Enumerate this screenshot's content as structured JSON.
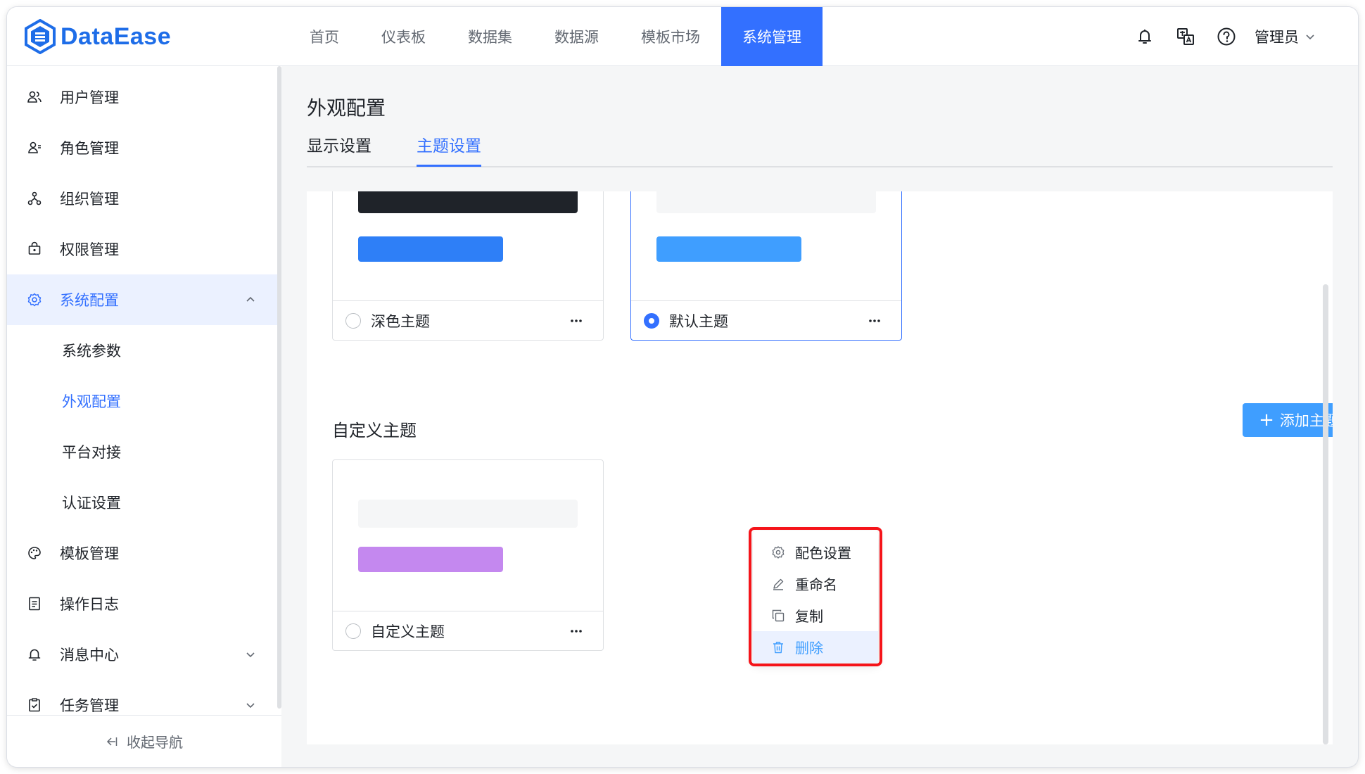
{
  "app": {
    "logo_text": "DataEase"
  },
  "topnav": {
    "items": [
      "首页",
      "仪表板",
      "数据集",
      "数据源",
      "模板市场",
      "系统管理"
    ],
    "active_index": 5
  },
  "header": {
    "icons": [
      "bell-icon",
      "translate-icon",
      "help-icon"
    ],
    "user_name": "管理员"
  },
  "sidebar": {
    "items": [
      {
        "label": "用户管理",
        "icon": "user-icon"
      },
      {
        "label": "角色管理",
        "icon": "role-icon"
      },
      {
        "label": "组织管理",
        "icon": "org-icon"
      },
      {
        "label": "权限管理",
        "icon": "lock-icon"
      },
      {
        "label": "系统配置",
        "icon": "gear-icon",
        "expanded": true
      },
      {
        "label": "系统参数",
        "sub": true
      },
      {
        "label": "外观配置",
        "sub": true,
        "active": true
      },
      {
        "label": "平台对接",
        "sub": true
      },
      {
        "label": "认证设置",
        "sub": true
      },
      {
        "label": "模板管理",
        "icon": "palette-icon"
      },
      {
        "label": "操作日志",
        "icon": "log-icon"
      },
      {
        "label": "消息中心",
        "icon": "bell-icon",
        "chevron": "down"
      },
      {
        "label": "任务管理",
        "icon": "task-icon",
        "chevron": "down"
      }
    ],
    "collapse_label": "收起导航"
  },
  "main": {
    "title": "外观配置",
    "tabs": [
      {
        "label": "显示设置",
        "active": false
      },
      {
        "label": "主题设置",
        "active": true
      }
    ],
    "builtin_themes": [
      {
        "name": "深色主题",
        "selected": false,
        "colors": {
          "top": "#1f2329",
          "bar": "#2e7ff7"
        }
      },
      {
        "name": "默认主题",
        "selected": true,
        "colors": {
          "top": "#f5f6f7",
          "bar": "#3f9eff"
        }
      }
    ],
    "custom_section_title": "自定义主题",
    "add_button_label": "添加主题",
    "custom_themes": [
      {
        "name": "自定义主题",
        "selected": false,
        "colors": {
          "top": "#f5f6f7",
          "bar": "#c488ef"
        }
      }
    ],
    "context_menu": {
      "items": [
        {
          "label": "配色设置",
          "icon": "gear-icon"
        },
        {
          "label": "重命名",
          "icon": "pen-icon"
        },
        {
          "label": "复制",
          "icon": "copy-icon"
        },
        {
          "label": "删除",
          "icon": "trash-icon",
          "hover": true
        }
      ]
    }
  },
  "colors": {
    "primary": "#3370ff",
    "accent": "#3f9eff",
    "highlight": "#f5141a"
  }
}
